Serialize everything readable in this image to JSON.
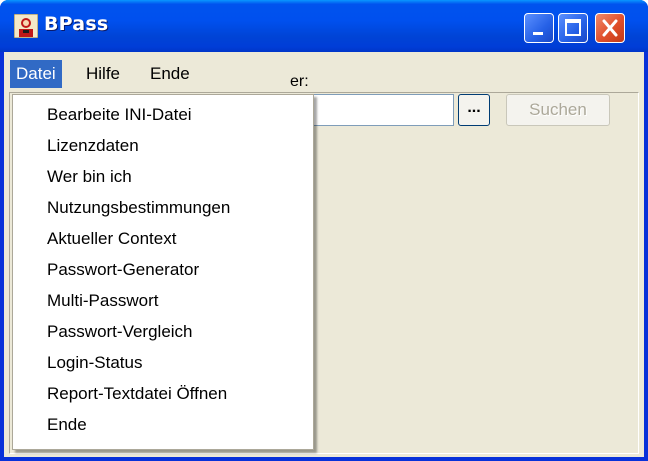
{
  "window": {
    "title": "BPass",
    "icon": "user-keyring-icon"
  },
  "titlebar_buttons": {
    "minimize": "minimize-icon",
    "maximize": "maximize-icon",
    "close": "close-icon"
  },
  "menubar": {
    "items": [
      {
        "label": "Datei"
      },
      {
        "label": "Hilfe"
      },
      {
        "label": "Ende"
      }
    ]
  },
  "datei_menu": {
    "items": [
      {
        "label": "Bearbeite INI-Datei"
      },
      {
        "label": "Lizenzdaten"
      },
      {
        "label": "Wer bin ich"
      },
      {
        "label": "Nutzungsbestimmungen"
      },
      {
        "label": "Aktueller Context"
      },
      {
        "label": "Passwort-Generator"
      },
      {
        "label": "Multi-Passwort"
      },
      {
        "label": "Passwort-Vergleich"
      },
      {
        "label": "Login-Status"
      },
      {
        "label": "Report-Textdatei Öffnen"
      },
      {
        "label": "Ende"
      }
    ]
  },
  "form": {
    "label_visible_fragment": "er:",
    "input_value": "",
    "browse_label": "...",
    "search_label": "Suchen"
  },
  "colors": {
    "titlebar_blue": "#0053ee",
    "menu_highlight": "#316ac5",
    "client_bg": "#ece9d8",
    "close_red": "#e04f2b"
  }
}
